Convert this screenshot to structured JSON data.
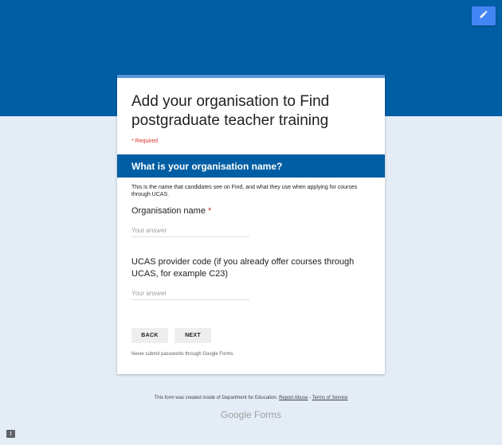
{
  "form": {
    "title": "Add your organisation to Find postgraduate teacher training",
    "required_note": "* Required",
    "section": {
      "title": "What is your organisation name?",
      "description": "This is the name that candidates see on Find, and what they use when applying for courses through UCAS."
    },
    "questions": [
      {
        "label": "Organisation name",
        "required_marker": "*",
        "placeholder": "Your answer"
      },
      {
        "label": "UCAS provider code (if you already offer courses through UCAS, for example C23)",
        "placeholder": "Your answer"
      }
    ],
    "buttons": {
      "back": "BACK",
      "next": "NEXT"
    },
    "password_note": "Never submit passwords through Google Forms."
  },
  "footer": {
    "created_text": "This form was created inside of Department for Education.",
    "report_abuse": "Report Abuse",
    "separator": "-",
    "terms": "Terms of Service",
    "brand_google": "Google",
    "brand_forms": "Forms"
  },
  "icons": {
    "edit": "pencil-icon",
    "report": "report-icon"
  },
  "colors": {
    "header": "#005ea5",
    "accent": "#4285f4",
    "required": "#d93025",
    "background": "#e4ecf5"
  }
}
